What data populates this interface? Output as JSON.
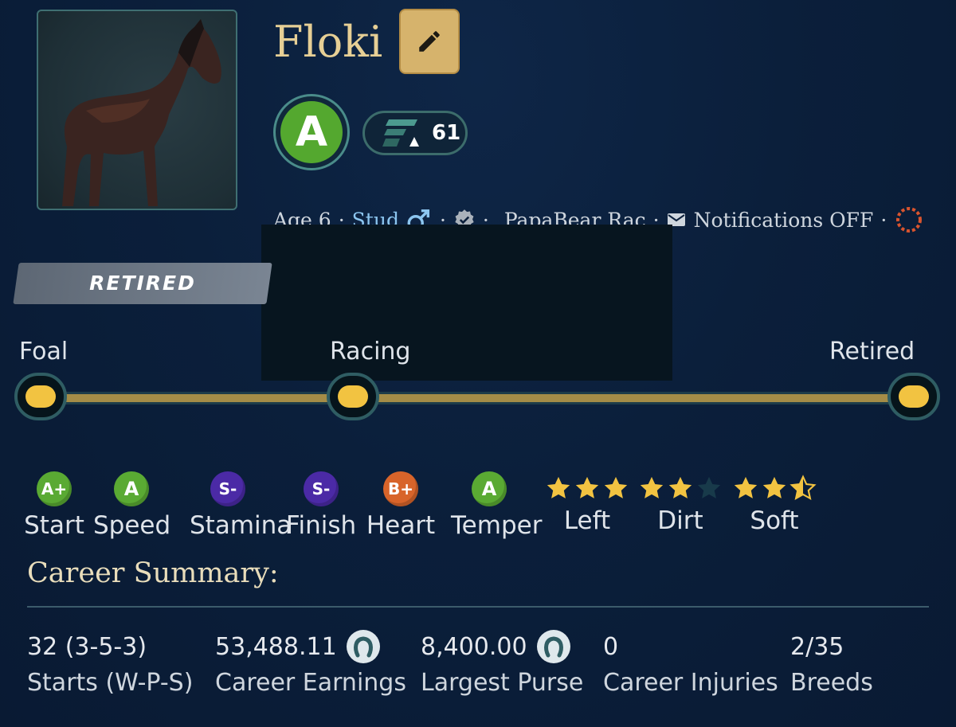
{
  "horse": {
    "name": "Floki",
    "grade": "A",
    "rating": "61",
    "age": "Age 6",
    "role": "Stud",
    "owner": "PapaBear Rac",
    "notifications": "Notifications OFF",
    "status": "RETIRED"
  },
  "lifecycle": {
    "stages": [
      "Foal",
      "Racing",
      "Retired"
    ]
  },
  "ratings": [
    {
      "grade": "A+",
      "label": "Start",
      "color": "#5aaa33"
    },
    {
      "grade": "A",
      "label": "Speed",
      "color": "#5aaa33"
    },
    {
      "grade": "S-",
      "label": "Stamina",
      "color": "#4b2aa6"
    },
    {
      "grade": "S-",
      "label": "Finish",
      "color": "#4b2aa6"
    },
    {
      "grade": "B+",
      "label": "Heart",
      "color": "#d8642a"
    },
    {
      "grade": "A",
      "label": "Temper",
      "color": "#5aaa33"
    }
  ],
  "surfaces": [
    {
      "label": "Left",
      "stars": 3
    },
    {
      "label": "Dirt",
      "stars": 2
    },
    {
      "label": "Soft",
      "stars": 2.5
    }
  ],
  "career": {
    "title": "Career Summary:",
    "stats": [
      {
        "value": "32 (3-5-3)",
        "label": "Starts (W-P-S)"
      },
      {
        "value": "53,488.11",
        "label": "Career Earnings"
      },
      {
        "value": "8,400.00",
        "label": "Largest Purse"
      },
      {
        "value": "0",
        "label": "Career Injuries"
      },
      {
        "value": "2/35",
        "label": "Breeds"
      }
    ]
  },
  "colors": {
    "gold": "#e6cf95",
    "star": "#f2c341",
    "link": "#8cc6f0"
  }
}
